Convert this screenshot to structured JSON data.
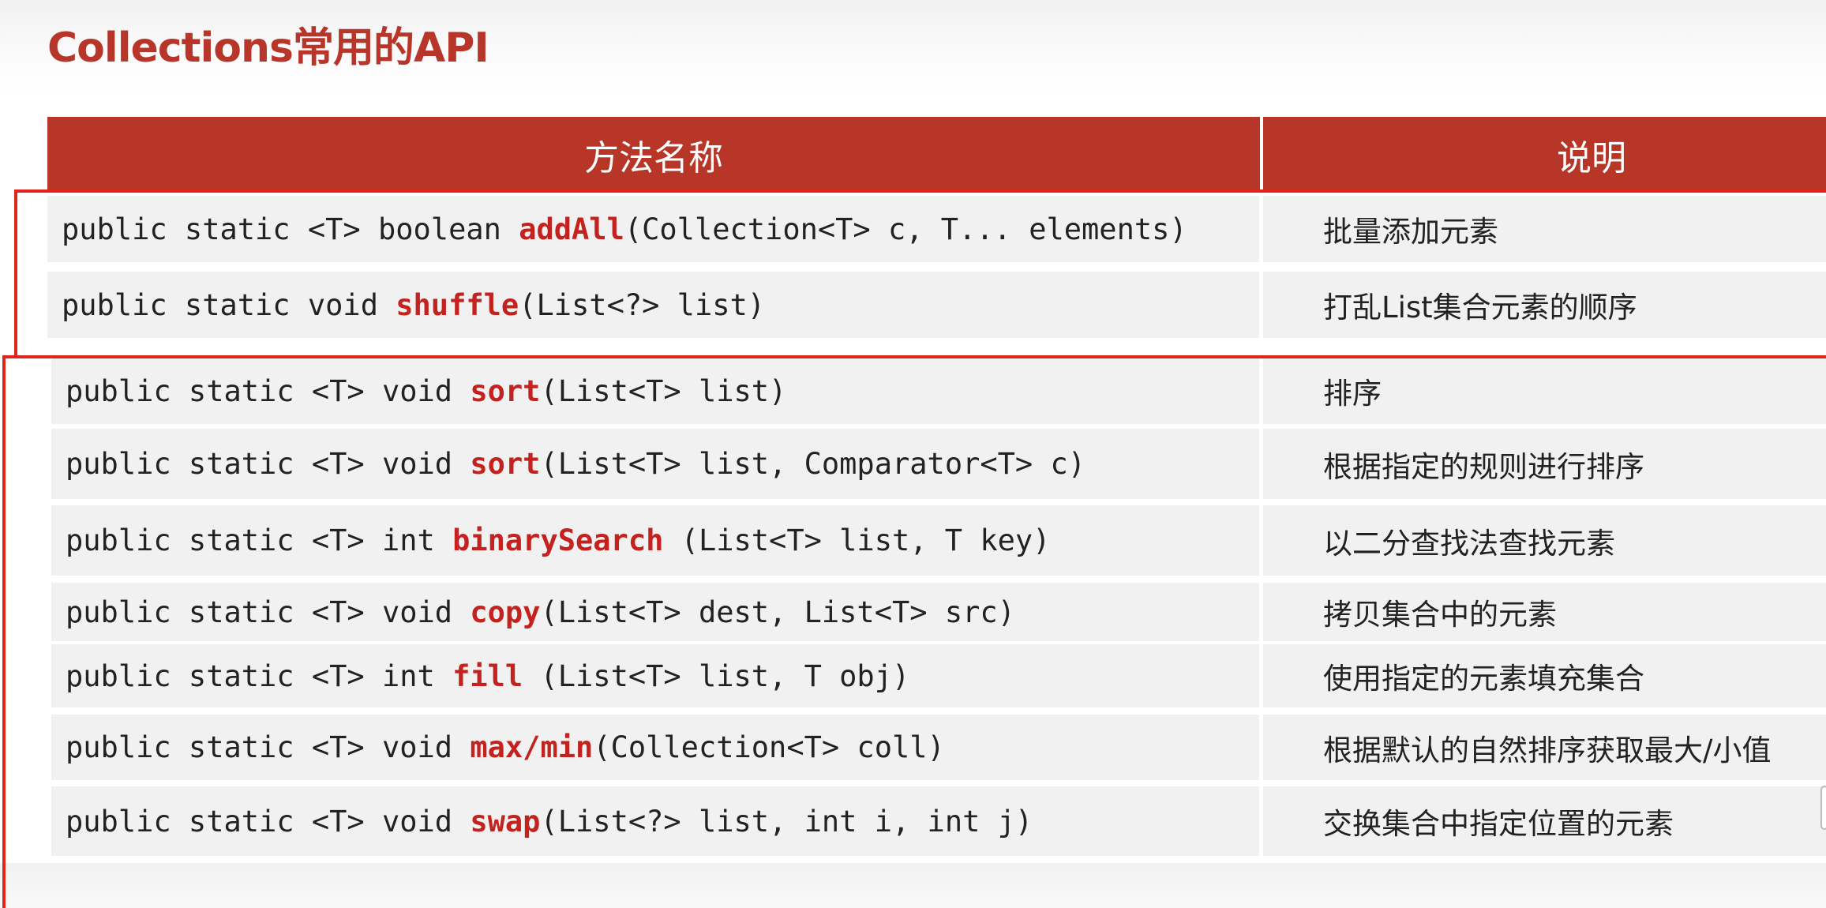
{
  "title": "Collections常用的API",
  "table": {
    "headers": {
      "method": "方法名称",
      "description": "说明"
    },
    "rows": [
      {
        "prefix": "public static <T> boolean ",
        "name": "addAll",
        "suffix": "(Collection<T> c, T... elements)",
        "description": "批量添加元素"
      },
      {
        "prefix": "public static void ",
        "name": "shuffle",
        "suffix": "(List<?> list)",
        "description": "打乱List集合元素的顺序"
      },
      {
        "prefix": "public static <T> void ",
        "name": "sort",
        "suffix": "(List<T> list)",
        "description": "排序"
      },
      {
        "prefix": "public static <T> void ",
        "name": "sort",
        "suffix": "(List<T> list, Comparator<T> c)",
        "description": "根据指定的规则进行排序"
      },
      {
        "prefix": "public static <T> int ",
        "name": "binarySearch",
        "suffix": " (List<T> list,  T key)",
        "description": "以二分查找法查找元素"
      },
      {
        "prefix": "public static <T> void ",
        "name": "copy",
        "suffix": "(List<T> dest, List<T> src)",
        "description": "拷贝集合中的元素"
      },
      {
        "prefix": "public static <T> int ",
        "name": "fill",
        "suffix": " (List<T> list,  T obj)",
        "description": "使用指定的元素填充集合"
      },
      {
        "prefix": "public static <T> void ",
        "name": "max/min",
        "suffix": "(Collection<T> coll)",
        "description": "根据默认的自然排序获取最大/小值"
      },
      {
        "prefix": "public static <T> void ",
        "name": "swap",
        "suffix": "(List<?> list, int i, int j)",
        "description": "交换集合中指定位置的元素"
      }
    ]
  },
  "colors": {
    "title": "#b8352a",
    "header_bg": "#b83628",
    "method_name": "#c4221e",
    "row_bg": "#f1f1f1",
    "bracket": "#e0261c"
  }
}
